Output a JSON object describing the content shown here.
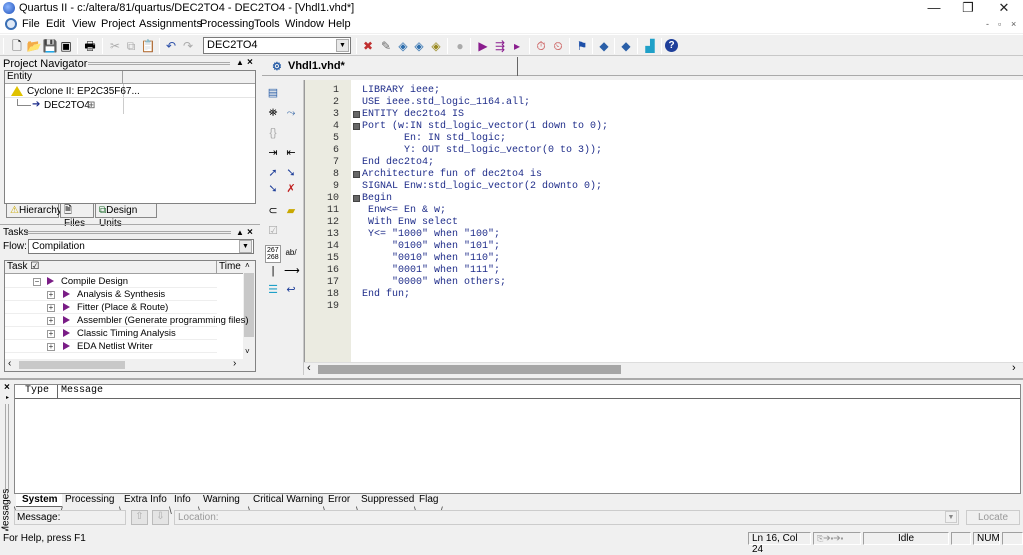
{
  "window": {
    "title": "Quartus II - c:/altera/81/quartus/DEC2TO4 - DEC2TO4 - [Vhdl1.vhd*]",
    "minimize": "—",
    "restore": "❐",
    "close": "✕"
  },
  "menu": {
    "items": [
      "File",
      "Edit",
      "View",
      "Project",
      "Assignments",
      "Processing",
      "Tools",
      "Window",
      "Help"
    ],
    "mdi_controls": [
      "-",
      "▫",
      "×"
    ]
  },
  "toolbar": {
    "entity_selector": "DEC2TO4"
  },
  "project_navigator": {
    "title": "Project Navigator",
    "column_header": "Entity",
    "device": "Cyclone II: EP2C35F67...",
    "top_entity": "DEC2TO4",
    "tabs": [
      "Hierarchy",
      "Files",
      "Design Units"
    ]
  },
  "tasks": {
    "title": "Tasks",
    "flow_label": "Flow:",
    "flow_value": "Compilation",
    "col_task": "Task",
    "col_time": "Time (",
    "items": [
      {
        "label": "Compile Design",
        "level": 0
      },
      {
        "label": "Analysis & Synthesis",
        "level": 1
      },
      {
        "label": "Fitter (Place & Route)",
        "level": 1
      },
      {
        "label": "Assembler (Generate programming files)",
        "level": 1
      },
      {
        "label": "Classic Timing Analysis",
        "level": 1
      },
      {
        "label": "EDA Netlist Writer",
        "level": 1
      }
    ]
  },
  "editor": {
    "tab_label": "Vhdl1.vhd*",
    "lines": [
      {
        "n": "1",
        "text": "LIBRARY ieee;",
        "fold": false
      },
      {
        "n": "2",
        "text": "USE ieee.std_logic_1164.all;",
        "fold": false
      },
      {
        "n": "3",
        "text": "ENTITY dec2to4 IS",
        "fold": true
      },
      {
        "n": "4",
        "text": "Port (w:IN std_logic_vector(1 down to 0);",
        "fold": true
      },
      {
        "n": "5",
        "text": "       En: IN std_logic;",
        "fold": false
      },
      {
        "n": "6",
        "text": "       Y: OUT std_logic_vector(0 to 3));",
        "fold": false
      },
      {
        "n": "7",
        "text": "End dec2to4;",
        "fold": false
      },
      {
        "n": "8",
        "text": "Architecture fun of dec2to4 is",
        "fold": true
      },
      {
        "n": "9",
        "text": "SIGNAL Enw:std_logic_vector(2 downto 0);",
        "fold": false
      },
      {
        "n": "10",
        "text": "Begin",
        "fold": true
      },
      {
        "n": "11",
        "text": " Enw<= En & w;",
        "fold": false
      },
      {
        "n": "12",
        "text": " With Enw select",
        "fold": false
      },
      {
        "n": "13",
        "text": " Y<= \"1000\" when \"100\";",
        "fold": false
      },
      {
        "n": "14",
        "text": "     \"0100\" when \"101\";",
        "fold": false
      },
      {
        "n": "15",
        "text": "     \"0010\" when \"110\";",
        "fold": false
      },
      {
        "n": "16",
        "text": "     \"0001\" when \"111\";",
        "fold": false
      },
      {
        "n": "17",
        "text": "     \"0000\" when others;",
        "fold": false
      },
      {
        "n": "18",
        "text": "End fun;",
        "fold": false
      },
      {
        "n": "19",
        "text": "",
        "fold": false
      }
    ]
  },
  "messages": {
    "side_label": "Messages",
    "col_type": "Type",
    "col_message": "Message",
    "tabs": [
      "System",
      "Processing",
      "Extra Info",
      "Info",
      "Warning",
      "Critical Warning",
      "Error",
      "Suppressed",
      "Flag"
    ],
    "active_tab": "System",
    "message_label": "Message:",
    "location_placeholder": "Location:",
    "locate_button": "Locate"
  },
  "status": {
    "help": "For Help, press F1",
    "position": "Ln 16, Col 24",
    "state": "Idle",
    "num": "NUM"
  }
}
